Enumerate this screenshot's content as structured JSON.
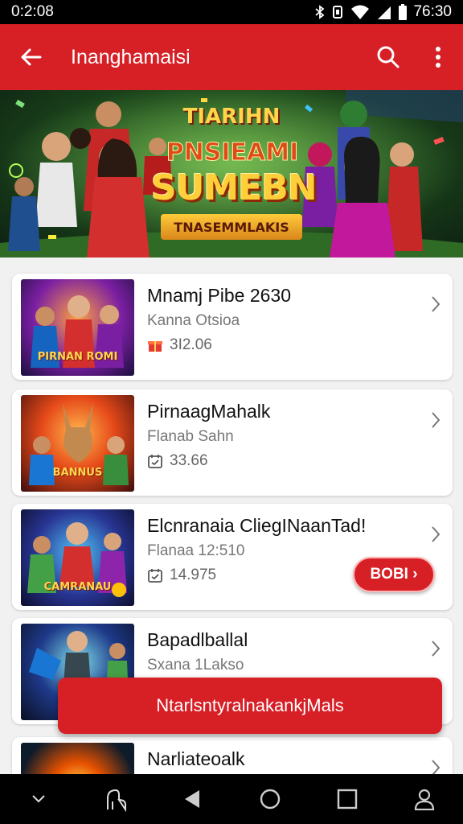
{
  "status_bar": {
    "time": "0:2:08",
    "clock": "76:30",
    "icons": [
      "bluetooth-icon",
      "vibrate-icon",
      "wifi-icon",
      "signal-icon",
      "battery-icon"
    ]
  },
  "app_bar": {
    "title": "Inanghamaisi",
    "icons": [
      "back-arrow-icon",
      "search-icon",
      "more-vert-icon"
    ]
  },
  "banner": {
    "line1": "TIARIHN",
    "line2": "PNSIEAMI",
    "headline": "SUMEBN",
    "strip": "TNASEMMLAKIS"
  },
  "cards": [
    {
      "title": "Mnamj Pibe 2630",
      "subtitle": "Kanna Otsioa",
      "meta": "3I2.06",
      "thumb_caption": "PIRNAN ROMI",
      "meta_icon": "gift-icon"
    },
    {
      "title": "PirnaagMahalk",
      "subtitle": "Flanab Sahn",
      "meta": "33.66",
      "thumb_caption": "BANNUS",
      "meta_icon": "calendar-icon"
    },
    {
      "title": "Elcnranaia CliegINaanTad!",
      "subtitle": "Flanaa 12:510",
      "meta": "14.975",
      "thumb_caption": "CAMRANAU",
      "meta_icon": "calendar-icon",
      "action": "BOBI ›"
    },
    {
      "title": "Bapadlballal",
      "subtitle": "Sxana 1Lakso",
      "meta": "",
      "thumb_caption": "",
      "meta_icon": ""
    },
    {
      "title": "Narliateoalk",
      "subtitle": "",
      "meta": "",
      "thumb_caption": ""
    }
  ],
  "snackbar": {
    "text": "NtarlsntyralnakankjMals"
  },
  "nav_bar": {
    "icons": [
      "chevron-down-icon",
      "assistant-icon",
      "back-icon",
      "home-icon",
      "recents-icon",
      "profile-icon"
    ]
  },
  "colors": {
    "accent": "#d71f26",
    "background": "#f1f1f1",
    "card": "#ffffff"
  }
}
